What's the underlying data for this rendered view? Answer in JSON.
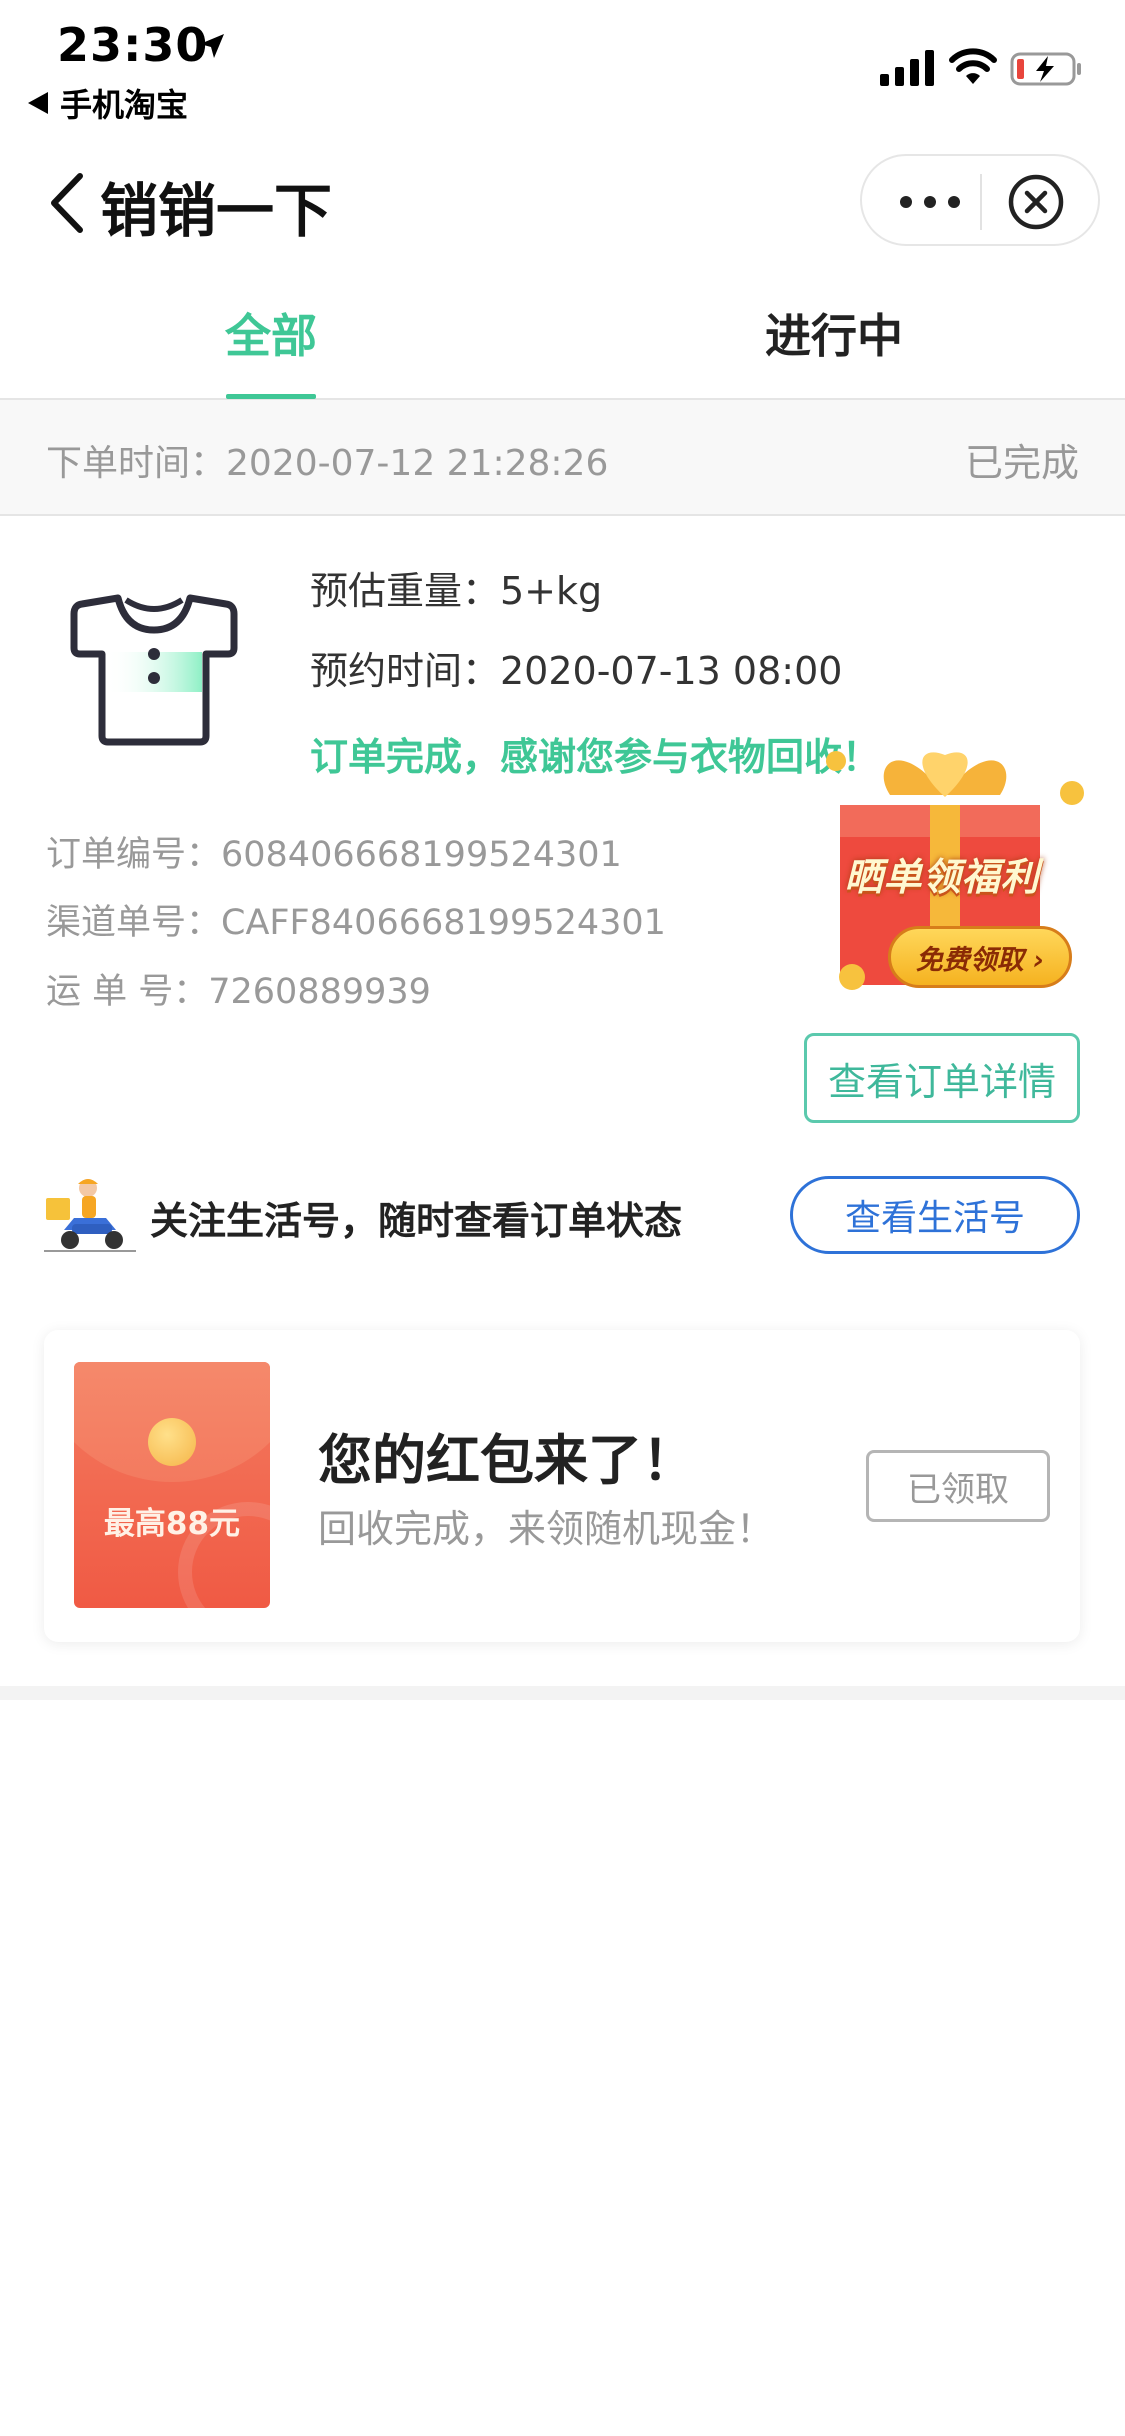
{
  "status_bar": {
    "time": "23:30",
    "back_app": "手机淘宝"
  },
  "nav": {
    "title": "销销一下"
  },
  "tabs": [
    {
      "label": "全部",
      "active": true
    },
    {
      "label": "进行中",
      "active": false
    }
  ],
  "order": {
    "time_label": "下单时间：",
    "time_value": "2020-07-12 21:28:26",
    "status": "已完成",
    "weight": "预估重量：5+kg",
    "appointment": "预约时间：2020-07-13 08:00",
    "complete_message": "订单完成，感谢您参与衣物回收！",
    "order_no": "订单编号：6084066681995243‌01",
    "channel_no": "渠道单号：CAFF8406668199524301",
    "waybill_no": "运 单 号：7260889939",
    "detail_button": "查看订单详情"
  },
  "gift_promo": {
    "label": "晒单领福利",
    "button": "免费领取 ›"
  },
  "follow": {
    "text": "关注生活号，随时查看订单状态",
    "button": "查看生活号"
  },
  "red_packet": {
    "amount": "最高88元",
    "title": "您的红包来了！",
    "subtitle": "回收完成，来领随机现金！",
    "button": "已领取"
  },
  "colors": {
    "accent_green": "#3fc796",
    "link_blue": "#2e72d8",
    "red_packet": "#f05a44"
  }
}
